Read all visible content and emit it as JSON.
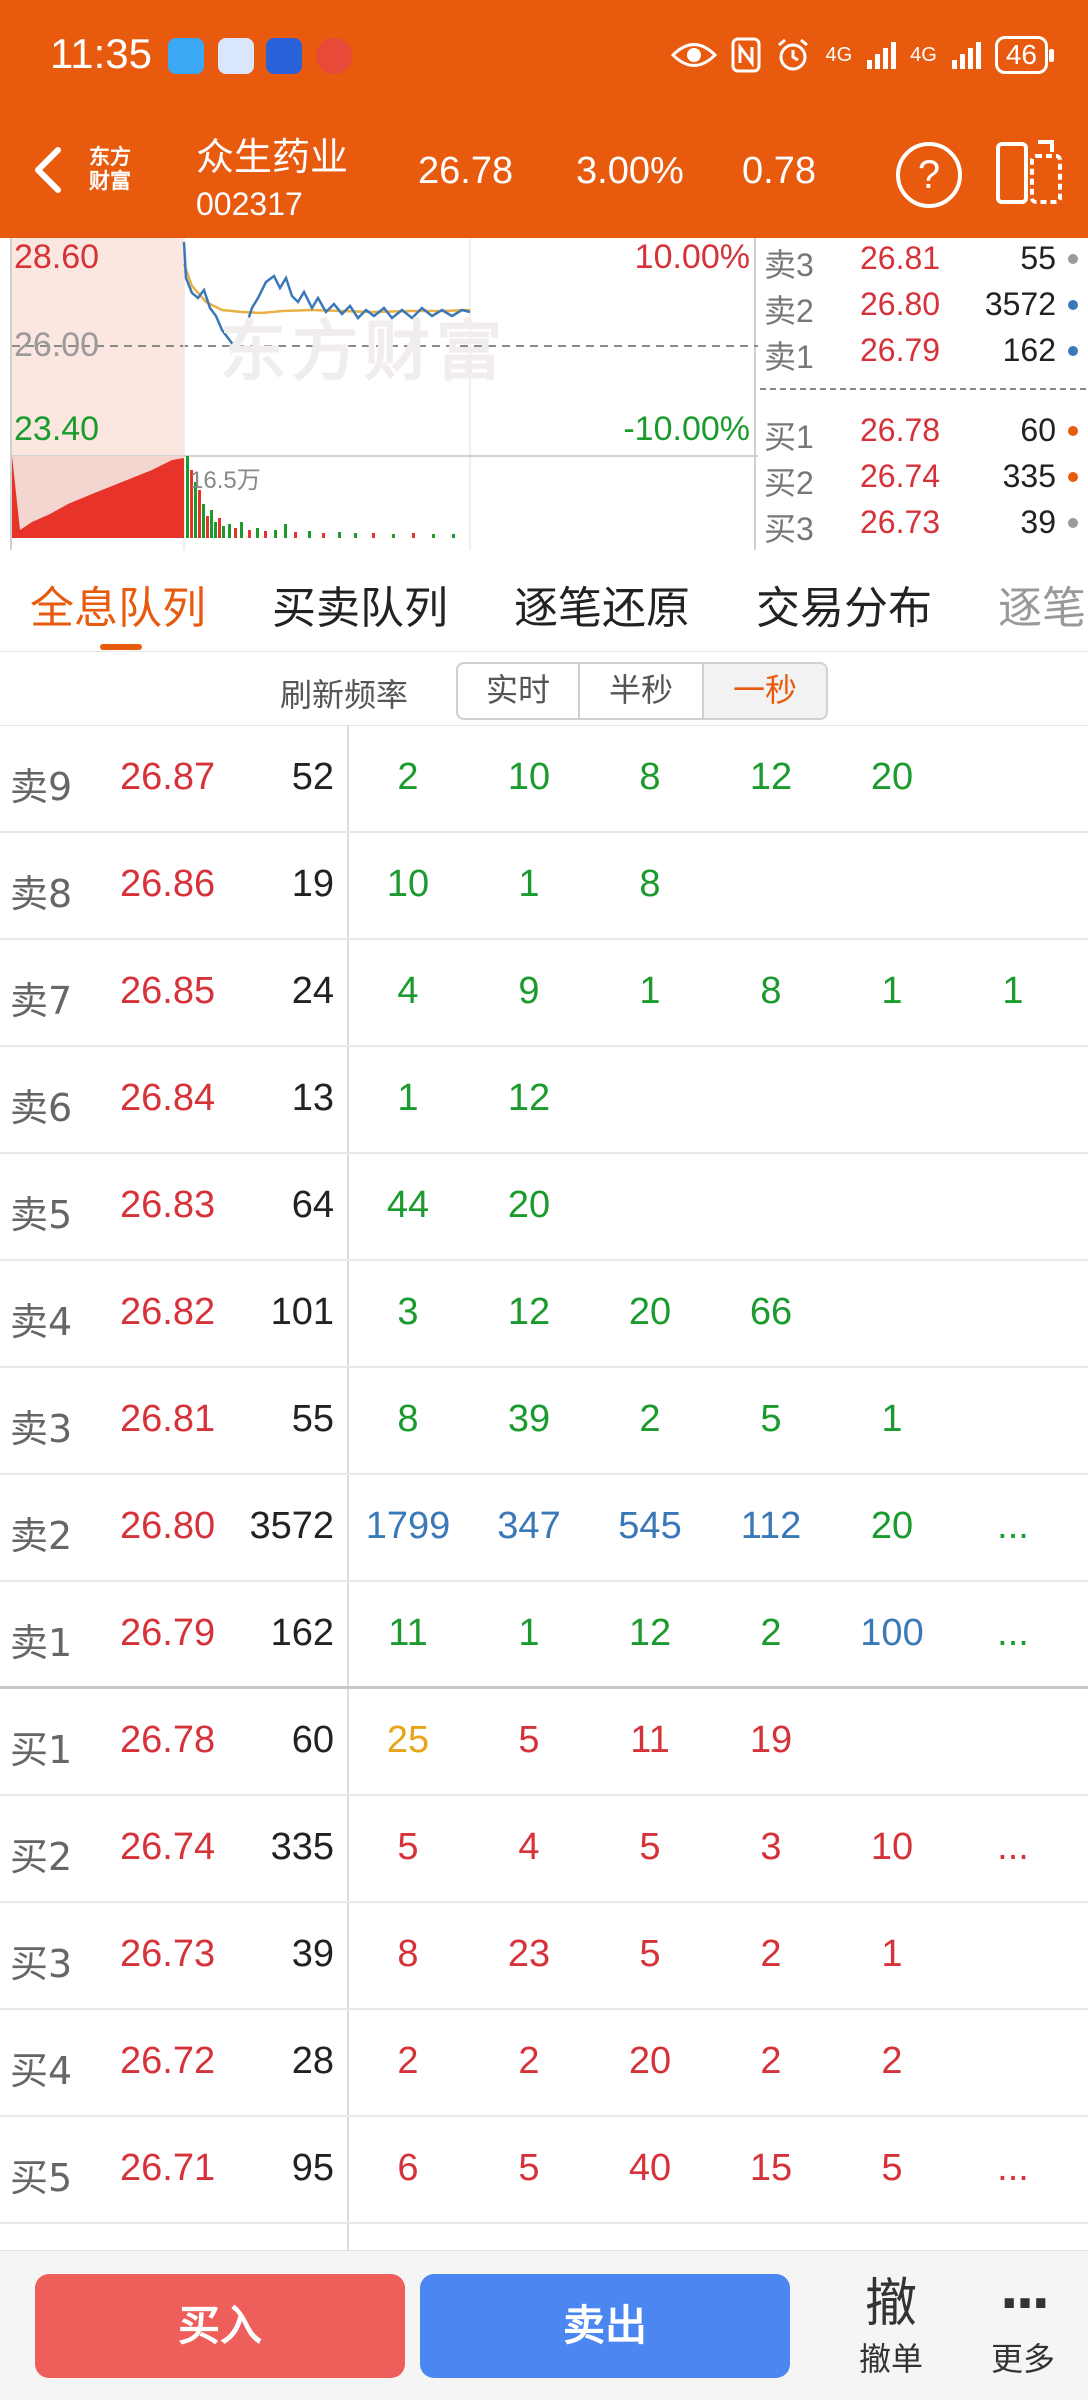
{
  "status_bar": {
    "time": "11:35",
    "network1": "4G",
    "network2": "4G",
    "battery": "46"
  },
  "header": {
    "logo_line1": "东方",
    "logo_line2": "财富",
    "stock_name": "众生药业",
    "stock_code": "002317",
    "price": "26.78",
    "change_pct": "3.00%",
    "change": "0.78",
    "help": "?"
  },
  "chart": {
    "high": "28.60",
    "mid": "26.00",
    "low": "23.40",
    "high_pct": "10.00%",
    "low_pct": "-10.00%",
    "volume_label": "16.5万",
    "watermark": "东方财富"
  },
  "mini_book": [
    {
      "label": "卖3",
      "price": "26.81",
      "vol": "55",
      "dot": "#9a9a9a"
    },
    {
      "label": "卖2",
      "price": "26.80",
      "vol": "3572",
      "dot": "#3a78b8"
    },
    {
      "label": "卖1",
      "price": "26.79",
      "vol": "162",
      "dot": "#3a78b8"
    },
    {
      "label": "买1",
      "price": "26.78",
      "vol": "60",
      "dot": "#e85a0e"
    },
    {
      "label": "买2",
      "price": "26.74",
      "vol": "335",
      "dot": "#e85a0e"
    },
    {
      "label": "买3",
      "price": "26.73",
      "vol": "39",
      "dot": "#9a9a9a"
    }
  ],
  "tabs": [
    "全息队列",
    "买卖队列",
    "逐笔还原",
    "交易分布",
    "逐笔"
  ],
  "refresh": {
    "label": "刷新频率",
    "options": [
      "实时",
      "半秒",
      "一秒"
    ],
    "selected": "一秒"
  },
  "queue": [
    {
      "label": "卖9",
      "price": "26.87",
      "vol": "52",
      "cells": [
        {
          "v": "2",
          "c": "green"
        },
        {
          "v": "10",
          "c": "green"
        },
        {
          "v": "8",
          "c": "green"
        },
        {
          "v": "12",
          "c": "green"
        },
        {
          "v": "20",
          "c": "green"
        }
      ]
    },
    {
      "label": "卖8",
      "price": "26.86",
      "vol": "19",
      "cells": [
        {
          "v": "10",
          "c": "green"
        },
        {
          "v": "1",
          "c": "green"
        },
        {
          "v": "8",
          "c": "green"
        }
      ]
    },
    {
      "label": "卖7",
      "price": "26.85",
      "vol": "24",
      "cells": [
        {
          "v": "4",
          "c": "green"
        },
        {
          "v": "9",
          "c": "green"
        },
        {
          "v": "1",
          "c": "green"
        },
        {
          "v": "8",
          "c": "green"
        },
        {
          "v": "1",
          "c": "green"
        },
        {
          "v": "1",
          "c": "green"
        }
      ]
    },
    {
      "label": "卖6",
      "price": "26.84",
      "vol": "13",
      "cells": [
        {
          "v": "1",
          "c": "green"
        },
        {
          "v": "12",
          "c": "green"
        }
      ]
    },
    {
      "label": "卖5",
      "price": "26.83",
      "vol": "64",
      "cells": [
        {
          "v": "44",
          "c": "green"
        },
        {
          "v": "20",
          "c": "green"
        }
      ]
    },
    {
      "label": "卖4",
      "price": "26.82",
      "vol": "101",
      "cells": [
        {
          "v": "3",
          "c": "green"
        },
        {
          "v": "12",
          "c": "green"
        },
        {
          "v": "20",
          "c": "green"
        },
        {
          "v": "66",
          "c": "green"
        }
      ]
    },
    {
      "label": "卖3",
      "price": "26.81",
      "vol": "55",
      "cells": [
        {
          "v": "8",
          "c": "green"
        },
        {
          "v": "39",
          "c": "green"
        },
        {
          "v": "2",
          "c": "green"
        },
        {
          "v": "5",
          "c": "green"
        },
        {
          "v": "1",
          "c": "green"
        }
      ]
    },
    {
      "label": "卖2",
      "price": "26.80",
      "vol": "3572",
      "cells": [
        {
          "v": "1799",
          "c": "blue"
        },
        {
          "v": "347",
          "c": "blue"
        },
        {
          "v": "545",
          "c": "blue"
        },
        {
          "v": "112",
          "c": "blue"
        },
        {
          "v": "20",
          "c": "green"
        },
        {
          "v": "...",
          "c": "green"
        }
      ]
    },
    {
      "label": "卖1",
      "price": "26.79",
      "vol": "162",
      "cells": [
        {
          "v": "11",
          "c": "green"
        },
        {
          "v": "1",
          "c": "green"
        },
        {
          "v": "12",
          "c": "green"
        },
        {
          "v": "2",
          "c": "green"
        },
        {
          "v": "100",
          "c": "blue"
        },
        {
          "v": "...",
          "c": "green"
        }
      ]
    },
    {
      "label": "买1",
      "price": "26.78",
      "vol": "60",
      "cells": [
        {
          "v": "25",
          "c": "orange"
        },
        {
          "v": "5",
          "c": "red"
        },
        {
          "v": "11",
          "c": "red"
        },
        {
          "v": "19",
          "c": "red"
        }
      ]
    },
    {
      "label": "买2",
      "price": "26.74",
      "vol": "335",
      "cells": [
        {
          "v": "5",
          "c": "red"
        },
        {
          "v": "4",
          "c": "red"
        },
        {
          "v": "5",
          "c": "red"
        },
        {
          "v": "3",
          "c": "red"
        },
        {
          "v": "10",
          "c": "red"
        },
        {
          "v": "...",
          "c": "red"
        }
      ]
    },
    {
      "label": "买3",
      "price": "26.73",
      "vol": "39",
      "cells": [
        {
          "v": "8",
          "c": "red"
        },
        {
          "v": "23",
          "c": "red"
        },
        {
          "v": "5",
          "c": "red"
        },
        {
          "v": "2",
          "c": "red"
        },
        {
          "v": "1",
          "c": "red"
        }
      ]
    },
    {
      "label": "买4",
      "price": "26.72",
      "vol": "28",
      "cells": [
        {
          "v": "2",
          "c": "red"
        },
        {
          "v": "2",
          "c": "red"
        },
        {
          "v": "20",
          "c": "red"
        },
        {
          "v": "2",
          "c": "red"
        },
        {
          "v": "2",
          "c": "red"
        }
      ]
    },
    {
      "label": "买5",
      "price": "26.71",
      "vol": "95",
      "cells": [
        {
          "v": "6",
          "c": "red"
        },
        {
          "v": "5",
          "c": "red"
        },
        {
          "v": "40",
          "c": "red"
        },
        {
          "v": "15",
          "c": "red"
        },
        {
          "v": "5",
          "c": "red"
        },
        {
          "v": "...",
          "c": "red"
        }
      ]
    }
  ],
  "bottom": {
    "buy": "买入",
    "sell": "卖出",
    "cancel_icon": "撤",
    "cancel_label": "撤单",
    "more_icon": "···",
    "more_label": "更多"
  },
  "colors": {
    "brand": "#e85a0e",
    "up": "#d6323a",
    "down": "#1b9a2e",
    "big_order": "#3a78b8",
    "buy_button": "#ee5f5b",
    "sell_button": "#4c86f1"
  }
}
